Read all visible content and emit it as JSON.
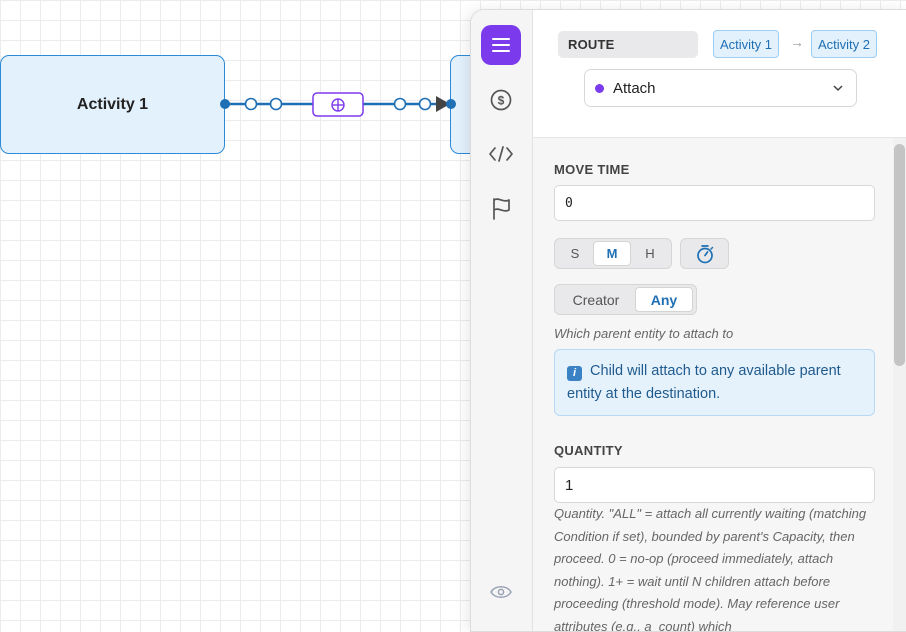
{
  "canvas": {
    "nodes": [
      {
        "label": "Activity 1"
      },
      {
        "label": ""
      }
    ],
    "edge_icon": "attach-icon"
  },
  "rail": {
    "icons": [
      "menu-icon",
      "dollar-icon",
      "code-icon",
      "flag-icon",
      "eye-icon"
    ],
    "accent": "#7c3aed"
  },
  "route": {
    "badge": "ROUTE",
    "from": "Activity 1",
    "to": "Activity 2",
    "arrow": "→",
    "type_select": {
      "value": "Attach",
      "dot_color": "#7c3aed"
    }
  },
  "move_time": {
    "label": "MOVE TIME",
    "value": "0",
    "units": [
      "S",
      "M",
      "H"
    ],
    "selected_unit": "M"
  },
  "attach_to": {
    "options": [
      "Creator",
      "Any"
    ],
    "selected": "Any",
    "hint": "Which parent entity to attach to",
    "info_icon": "i",
    "info": "Child will attach to any available parent entity at the destination."
  },
  "quantity": {
    "label": "QUANTITY",
    "value": "1",
    "description": "Quantity. \"ALL\" = attach all currently waiting (matching Condition if set), bounded by parent's Capacity, then proceed. 0 = no-op (proceed immediately, attach nothing). 1+ = wait until N children attach before proceeding (threshold mode). May reference user attributes (e.g., a_count) which"
  },
  "colors": {
    "node_fill": "#e3f1fc",
    "node_border": "#2d8ad6",
    "edge": "#1f6fb4",
    "accent_purple": "#7c3aed"
  }
}
